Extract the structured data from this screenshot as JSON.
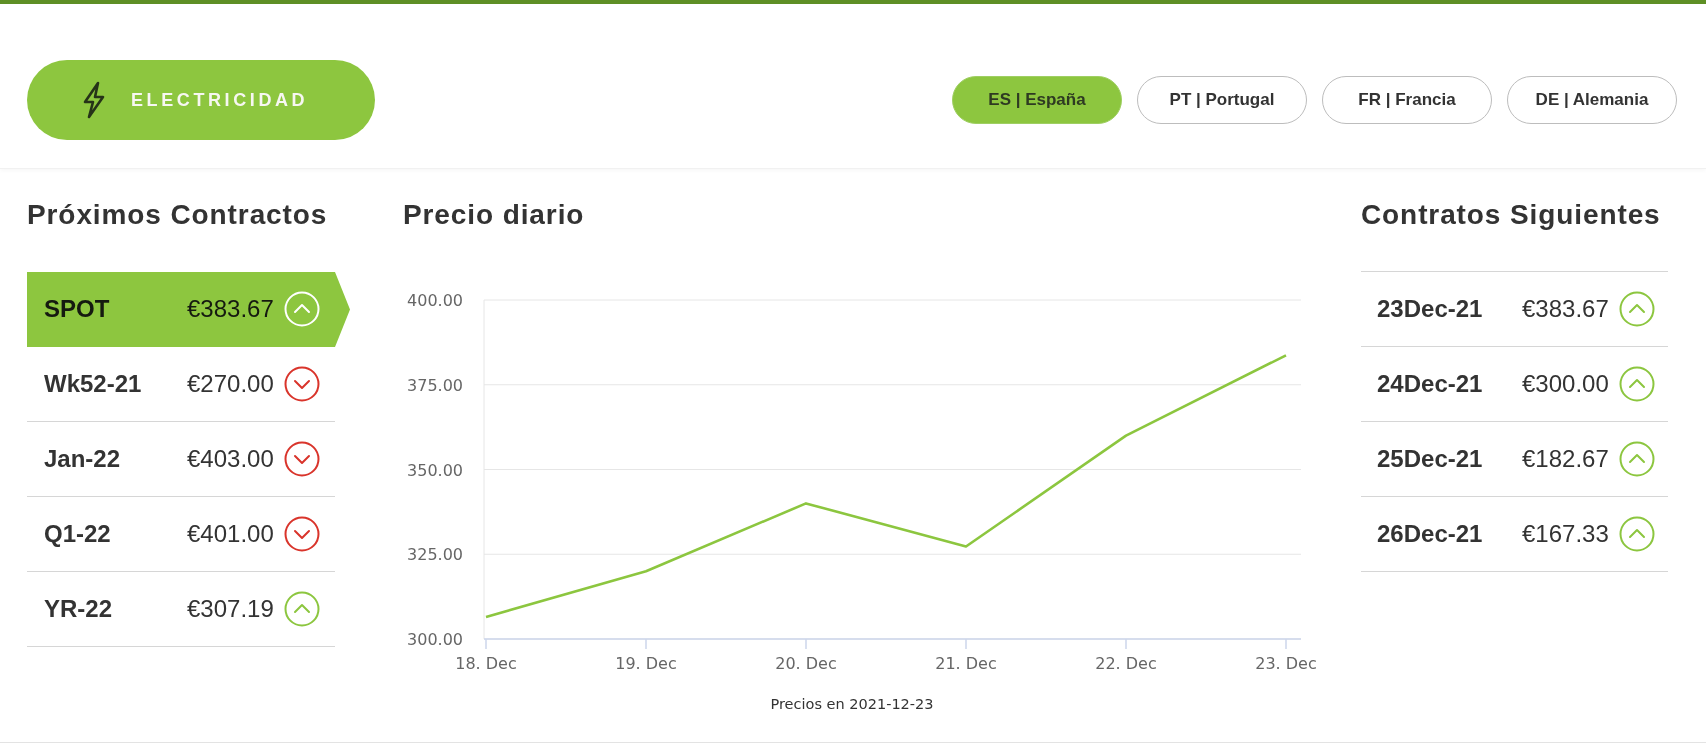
{
  "header": {
    "category_button": {
      "label": "ELECTRICIDAD"
    },
    "markets": [
      {
        "label": "ES | España",
        "selected": true
      },
      {
        "label": "PT | Portugal",
        "selected": false
      },
      {
        "label": "FR | Francia",
        "selected": false
      },
      {
        "label": "DE | Alemania",
        "selected": false
      }
    ]
  },
  "left_panel": {
    "title": "Próximos Contractos",
    "contracts": [
      {
        "label": "SPOT",
        "price": "€383.67",
        "rising": true,
        "selected": true
      },
      {
        "label": "Wk52-21",
        "price": "€270.00",
        "rising": false,
        "selected": false
      },
      {
        "label": "Jan-22",
        "price": "€403.00",
        "rising": false,
        "selected": false
      },
      {
        "label": "Q1-22",
        "price": "€401.00",
        "rising": false,
        "selected": false
      },
      {
        "label": "YR-22",
        "price": "€307.19",
        "rising": true,
        "selected": false
      }
    ]
  },
  "chart_panel": {
    "title": "Precio diario",
    "chart_data": {
      "type": "line",
      "categories": [
        "18. Dec",
        "19. Dec",
        "20. Dec",
        "21. Dec",
        "22. Dec",
        "23. Dec"
      ],
      "values": [
        306.5,
        320,
        340,
        327.3,
        360,
        383.7
      ],
      "ylim": [
        300,
        400
      ],
      "yticks": [
        {
          "value": 400,
          "label": "400.00"
        },
        {
          "value": 375,
          "label": "375.00"
        },
        {
          "value": 350,
          "label": "350.00"
        },
        {
          "value": 325,
          "label": "325.00"
        },
        {
          "value": 300,
          "label": "300.00"
        }
      ],
      "grid": true
    },
    "caption": "Precios en 2021-12-23"
  },
  "right_panel": {
    "title": "Contratos Siguientes",
    "contracts": [
      {
        "label": "23Dec-21",
        "price": "€383.67",
        "rising": true
      },
      {
        "label": "24Dec-21",
        "price": "€300.00",
        "rising": true
      },
      {
        "label": "25Dec-21",
        "price": "€182.67",
        "rising": true
      },
      {
        "label": "26Dec-21",
        "price": "€167.33",
        "rising": true
      }
    ]
  }
}
